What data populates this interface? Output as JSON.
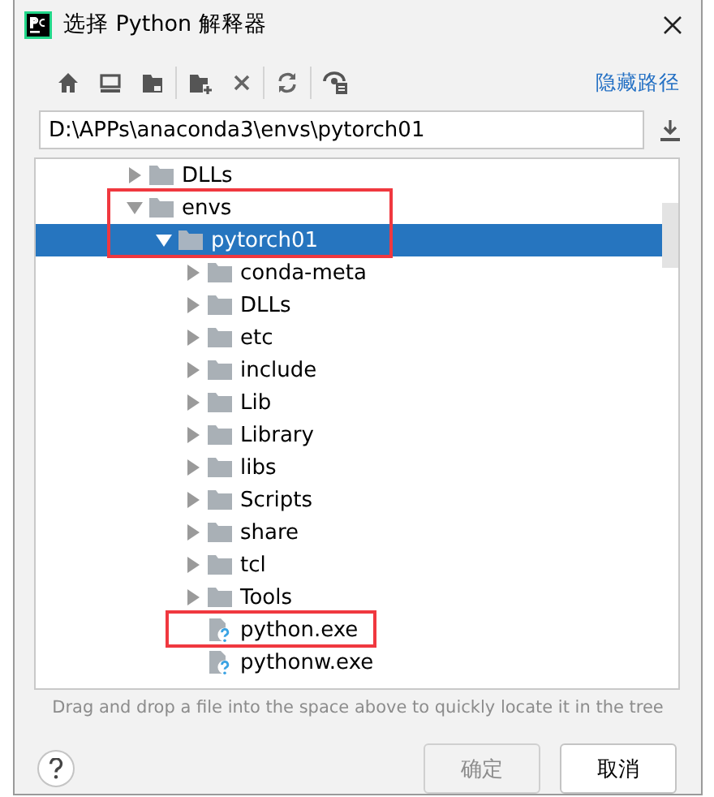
{
  "window": {
    "title": "选择 Python 解释器"
  },
  "toolbar": {
    "link": "隐藏路径"
  },
  "path_field": {
    "value": "D:\\APPs\\anaconda3\\envs\\pytorch01"
  },
  "tree": [
    {
      "label": "DLLs",
      "kind": "folder",
      "expanded": false,
      "selected": false,
      "highlighted": false
    },
    {
      "label": "envs",
      "kind": "folder",
      "expanded": true,
      "selected": false,
      "highlighted": true,
      "children": [
        {
          "label": "pytorch01",
          "kind": "folder",
          "expanded": true,
          "selected": true,
          "highlighted": true,
          "children": [
            {
              "label": "conda-meta",
              "kind": "folder",
              "expanded": false,
              "selected": false,
              "highlighted": false
            },
            {
              "label": "DLLs",
              "kind": "folder",
              "expanded": false,
              "selected": false,
              "highlighted": false
            },
            {
              "label": "etc",
              "kind": "folder",
              "expanded": false,
              "selected": false,
              "highlighted": false
            },
            {
              "label": "include",
              "kind": "folder",
              "expanded": false,
              "selected": false,
              "highlighted": false
            },
            {
              "label": "Lib",
              "kind": "folder",
              "expanded": false,
              "selected": false,
              "highlighted": false
            },
            {
              "label": "Library",
              "kind": "folder",
              "expanded": false,
              "selected": false,
              "highlighted": false
            },
            {
              "label": "libs",
              "kind": "folder",
              "expanded": false,
              "selected": false,
              "highlighted": false
            },
            {
              "label": "Scripts",
              "kind": "folder",
              "expanded": false,
              "selected": false,
              "highlighted": false
            },
            {
              "label": "share",
              "kind": "folder",
              "expanded": false,
              "selected": false,
              "highlighted": false
            },
            {
              "label": "tcl",
              "kind": "folder",
              "expanded": false,
              "selected": false,
              "highlighted": false
            },
            {
              "label": "Tools",
              "kind": "folder",
              "expanded": false,
              "selected": false,
              "highlighted": false
            },
            {
              "label": "python.exe",
              "kind": "file",
              "selected": false,
              "highlighted": true
            },
            {
              "label": "pythonw.exe",
              "kind": "file",
              "selected": false,
              "highlighted": false
            }
          ]
        }
      ]
    }
  ],
  "hint": "Drag and drop a file into the space above to quickly locate it in the tree",
  "buttons": [
    {
      "label": "确定",
      "disabled": true
    },
    {
      "label": "取消",
      "disabled": false
    }
  ]
}
